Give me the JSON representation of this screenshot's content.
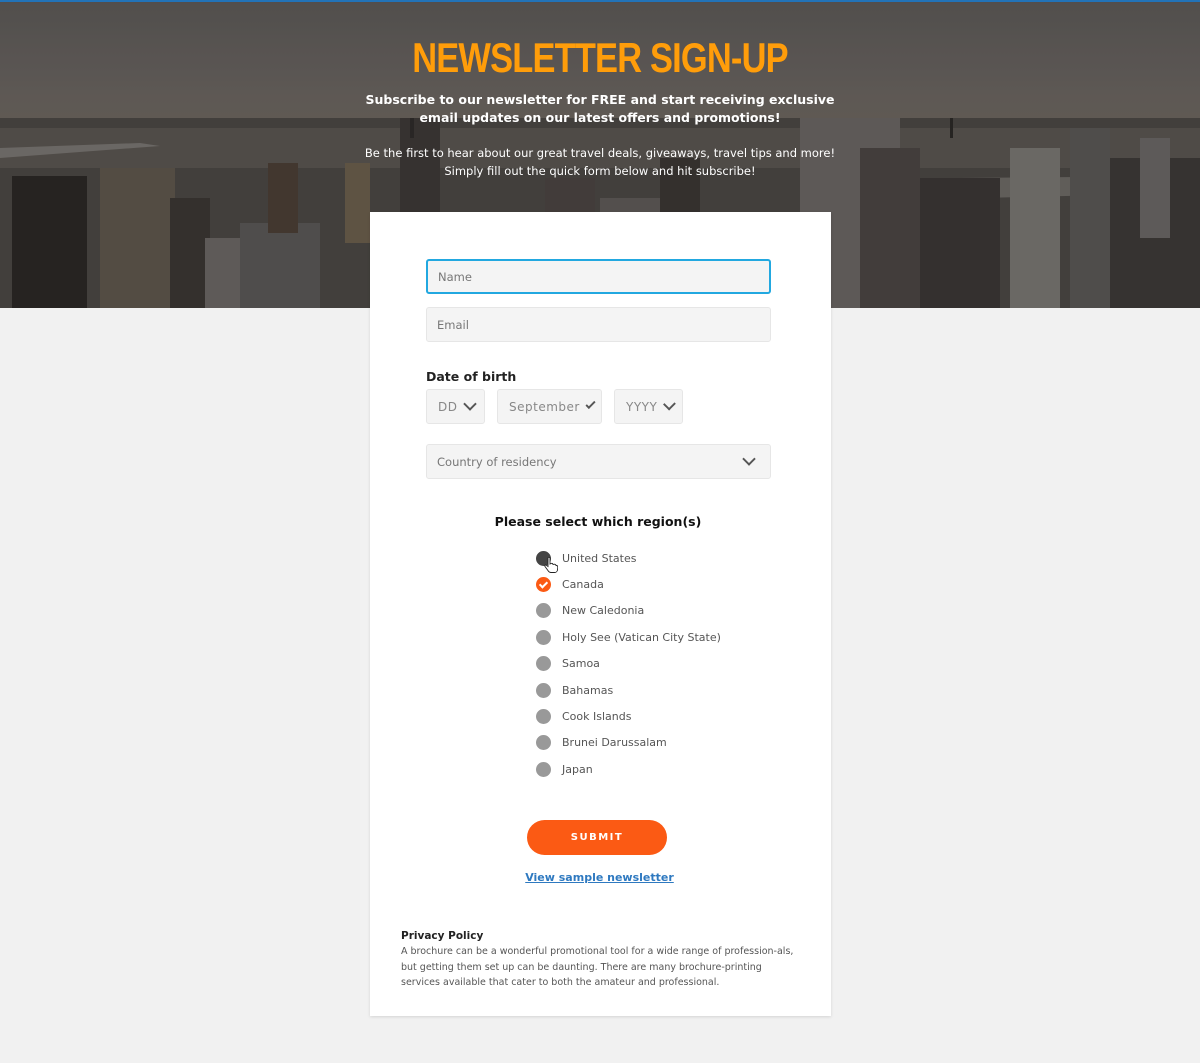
{
  "hero": {
    "title": "NEWSLETTER SIGN-UP",
    "subtitle_line1": "Subscribe to our newsletter for FREE and start receiving exclusive",
    "subtitle_line2": "email updates on our latest offers and promotions!",
    "body_line1": "Be the first to hear about our great travel deals, giveaways, travel tips and more!",
    "body_line2": "Simply fill out the quick form below and hit subscribe!"
  },
  "form": {
    "name_placeholder": "Name",
    "email_placeholder": "Email",
    "dob_label": "Date of birth",
    "dob_day": "DD",
    "dob_month": "September",
    "dob_year": "YYYY",
    "country_placeholder": "Country of residency",
    "regions_title": "Please select which region(s)",
    "regions": [
      {
        "label": "United States",
        "state": "hover"
      },
      {
        "label": "Canada",
        "state": "checked"
      },
      {
        "label": "New Caledonia",
        "state": "unchecked"
      },
      {
        "label": "Holy See (Vatican City State)",
        "state": "unchecked"
      },
      {
        "label": "Samoa",
        "state": "unchecked"
      },
      {
        "label": "Bahamas",
        "state": "unchecked"
      },
      {
        "label": "Cook Islands",
        "state": "unchecked"
      },
      {
        "label": "Brunei Darussalam",
        "state": "unchecked"
      },
      {
        "label": "Japan",
        "state": "unchecked"
      }
    ],
    "submit_label": "SUBMIT",
    "sample_link": "View sample newsletter"
  },
  "privacy": {
    "title": "Privacy Policy",
    "text": "A brochure can be a wonderful promotional tool for a wide range of profession-als, but getting them set up can be daunting. There are many brochure-printing services available that cater to both the amateur and professional."
  },
  "colors": {
    "title_orange": "#ff9d0a",
    "accent_orange": "#fb5a14",
    "focus_blue": "#22a8e0",
    "link_blue": "#2e79c0"
  }
}
